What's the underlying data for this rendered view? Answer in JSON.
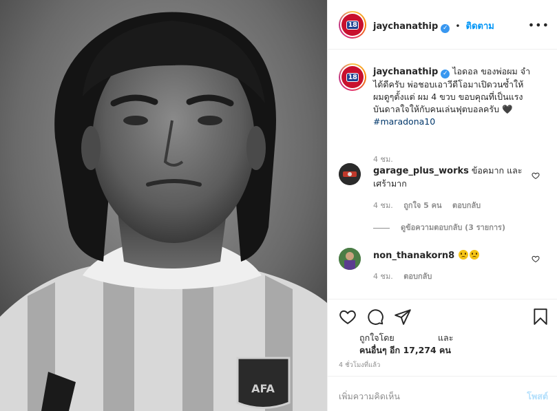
{
  "post": {
    "username": "jaychanathip",
    "verified_mark": "✓",
    "separator": "•",
    "follow_label": "ติดตาม",
    "more_icon": "more-icon",
    "avatar_text": "18"
  },
  "caption": {
    "username": "jaychanathip",
    "text": "ไอดอล ของพ่อผม จำได้ดีครับ พ่อชอบเอาวีดีโอมาเปิดวนซ้ำให้ผมดูๆตั้งแต่ ผม 4 ขวบ ขอบคุณที่เป็นแรงบันดาลใจให้กับคนเล่นฟุตบอลครับ 🖤",
    "hashtag": "#maradona10",
    "time": "4 ชม."
  },
  "comments": [
    {
      "username": "garage_plus_works",
      "text": "ข้อคมาก และ เศร้ามาก",
      "time": "4 ชม.",
      "likes": "ถูกใจ 5 คน",
      "reply": "ตอบกลับ",
      "view_replies": "ดูข้อความตอบกลับ (3 รายการ)"
    },
    {
      "username": "non_thanakorn8",
      "text": "",
      "time": "4 ชม.",
      "reply": "ตอบกลับ"
    }
  ],
  "actions": {
    "like_icon": "heart-icon",
    "comment_icon": "comment-icon",
    "share_icon": "send-icon",
    "save_icon": "bookmark-icon"
  },
  "likes": {
    "prefix": "ถูกใจโดย",
    "and": "และ",
    "others": "คนอื่นๆ อีก 17,274 คน"
  },
  "timestamp": "4 ชั่วโมงที่แล้ว",
  "add_comment": {
    "placeholder": "เพิ่มความคิดเห็น",
    "post_label": "โพสต์"
  },
  "colors": {
    "accent": "#0095f6",
    "verified": "#3897f0",
    "muted": "#8e8e8e",
    "post_disabled": "#b2dffc"
  }
}
